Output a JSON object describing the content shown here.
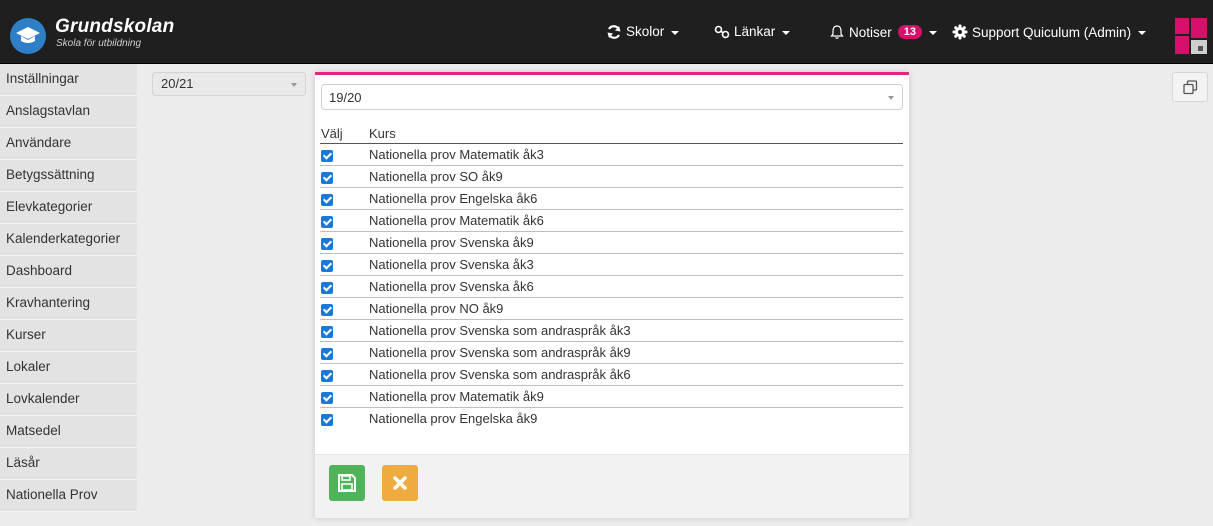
{
  "header": {
    "brand_title": "Grundskolan",
    "brand_subtitle": "Skola för utbildning",
    "nav": {
      "schools": "Skolor",
      "links": "Länkar",
      "notifications": "Notiser",
      "notification_count": "13",
      "user": "Support Quiculum (Admin)"
    },
    "accent_color": "#d6106a"
  },
  "sidebar": {
    "items": [
      "Inställningar",
      "Anslagstavlan",
      "Användare",
      "Betygssättning",
      "Elevkategorier",
      "Kalenderkategorier",
      "Dashboard",
      "Kravhantering",
      "Kurser",
      "Lokaler",
      "Lovkalender",
      "Matsedel",
      "Läsår",
      "Nationella Prov"
    ]
  },
  "year_select": {
    "value": "20/21"
  },
  "modal": {
    "source_year": "19/20",
    "columns": {
      "select": "Välj",
      "course": "Kurs"
    },
    "courses": [
      {
        "name": "Nationella prov Matematik åk3",
        "checked": true
      },
      {
        "name": "Nationella prov SO åk9",
        "checked": true
      },
      {
        "name": "Nationella prov Engelska åk6",
        "checked": true
      },
      {
        "name": "Nationella prov Matematik åk6",
        "checked": true
      },
      {
        "name": "Nationella prov Svenska åk9",
        "checked": true
      },
      {
        "name": "Nationella prov Svenska åk3",
        "checked": true
      },
      {
        "name": "Nationella prov Svenska åk6",
        "checked": true
      },
      {
        "name": "Nationella prov NO åk9",
        "checked": true
      },
      {
        "name": "Nationella prov Svenska som andraspråk åk3",
        "checked": true
      },
      {
        "name": "Nationella prov Svenska som andraspråk åk9",
        "checked": true
      },
      {
        "name": "Nationella prov Svenska som andraspråk åk6",
        "checked": true
      },
      {
        "name": "Nationella prov Matematik åk9",
        "checked": true
      },
      {
        "name": "Nationella prov Engelska åk9",
        "checked": true
      }
    ],
    "save_icon": "floppy-disk-icon",
    "cancel_icon": "close-icon",
    "accent_color": "#e0287e"
  },
  "copy_icon": "copy-icon"
}
